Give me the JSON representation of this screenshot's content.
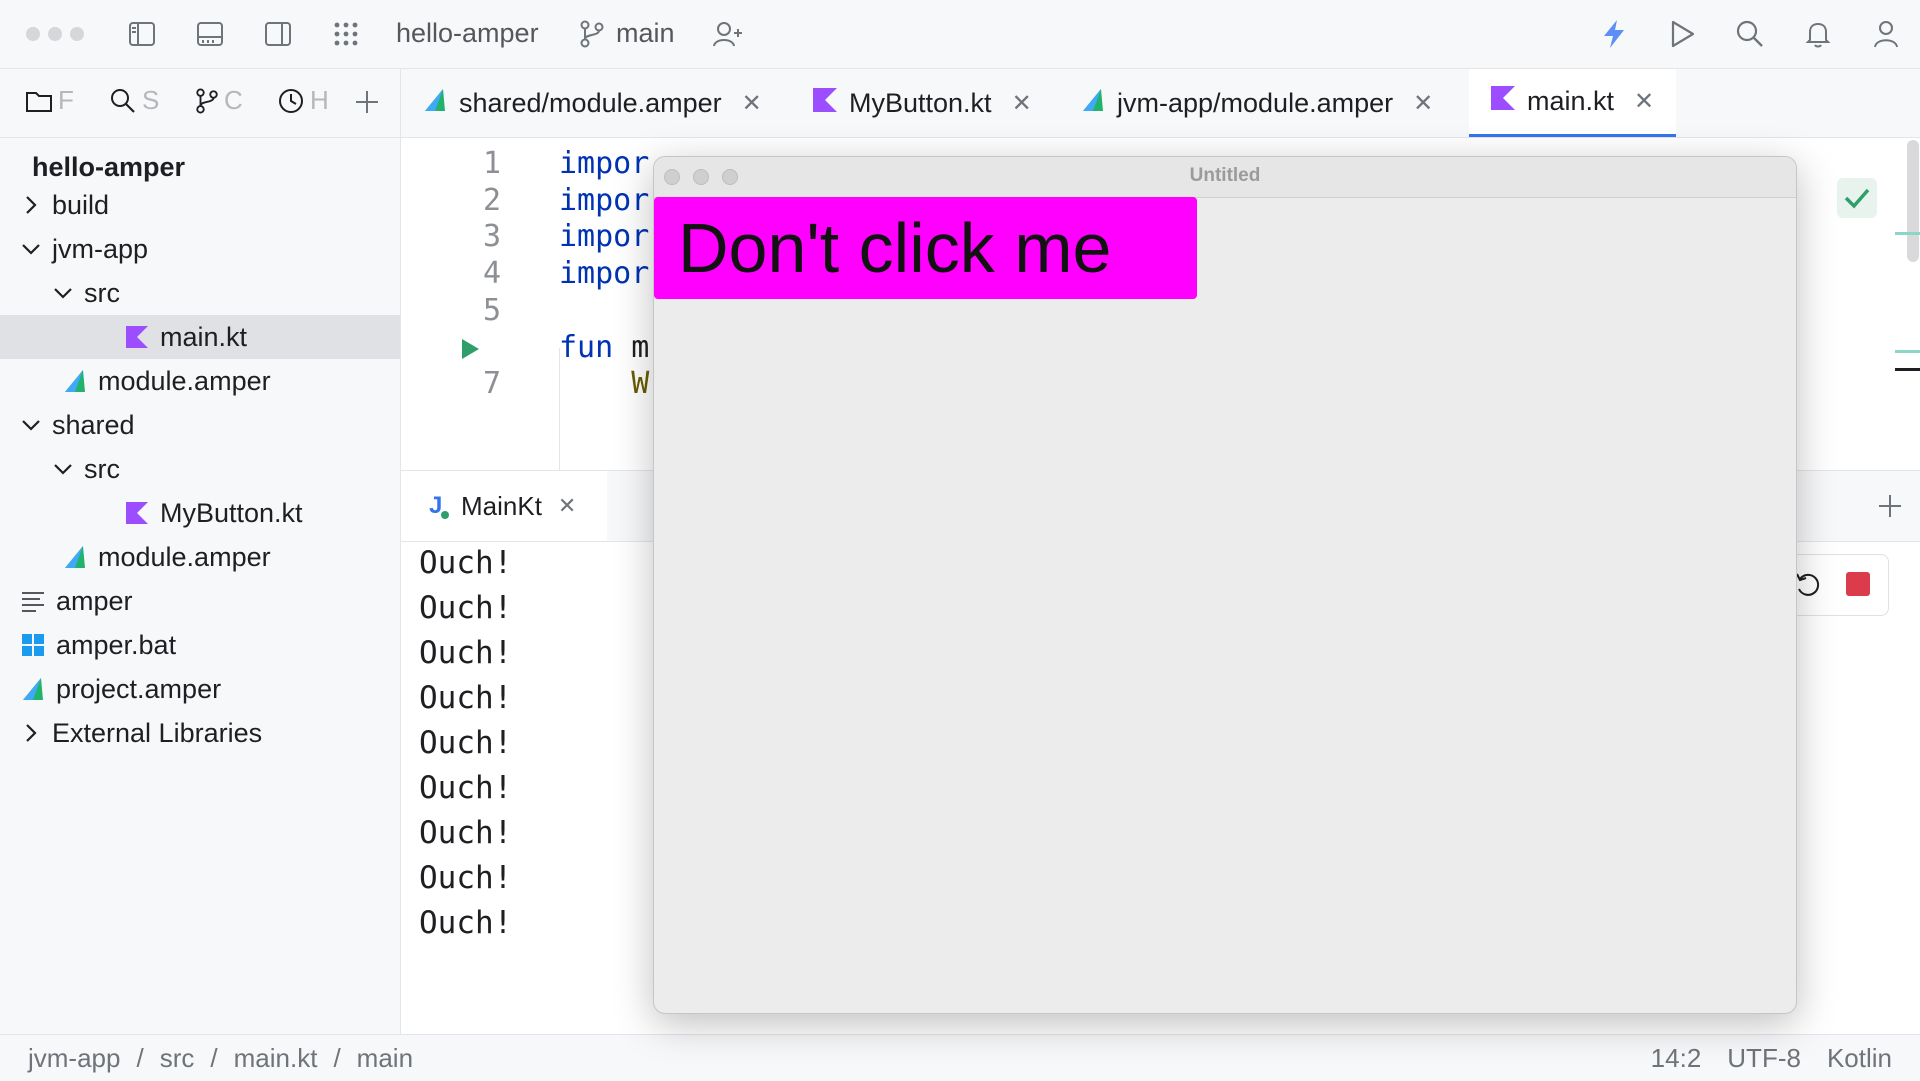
{
  "titlebar": {
    "project_name": "hello-amper",
    "branch": "main"
  },
  "tool_tabs": [
    {
      "icon": "folder-icon",
      "label": "F"
    },
    {
      "icon": "search-icon",
      "label": "S"
    },
    {
      "icon": "git-branch-icon",
      "label": "C"
    },
    {
      "icon": "clock-icon",
      "label": "H"
    }
  ],
  "tree": {
    "root": "hello-amper",
    "items": [
      {
        "label": "build",
        "depth": 0,
        "arrow": "right",
        "icon": ""
      },
      {
        "label": "jvm-app",
        "depth": 0,
        "arrow": "down",
        "icon": ""
      },
      {
        "label": "src",
        "depth": 1,
        "arrow": "down",
        "icon": ""
      },
      {
        "label": "main.kt",
        "depth": 2,
        "arrow": "",
        "icon": "kotlin-icon",
        "selected": true
      },
      {
        "label": "module.amper",
        "depth": 1,
        "arrow": "",
        "icon": "amper-icon"
      },
      {
        "label": "shared",
        "depth": 0,
        "arrow": "down",
        "icon": ""
      },
      {
        "label": "src",
        "depth": 1,
        "arrow": "down",
        "icon": ""
      },
      {
        "label": "MyButton.kt",
        "depth": 2,
        "arrow": "",
        "icon": "kotlin-icon"
      },
      {
        "label": "module.amper",
        "depth": 1,
        "arrow": "",
        "icon": "amper-icon"
      },
      {
        "label": "amper",
        "depth": 0,
        "arrow": "",
        "icon": "text-file-icon"
      },
      {
        "label": "amper.bat",
        "depth": 0,
        "arrow": "",
        "icon": "windows-icon"
      },
      {
        "label": "project.amper",
        "depth": 0,
        "arrow": "",
        "icon": "amper-icon"
      },
      {
        "label": "External Libraries",
        "depth": 0,
        "arrow": "right",
        "icon": ""
      }
    ]
  },
  "editor_tabs": [
    {
      "label": "shared/module.amper",
      "icon": "amper-icon"
    },
    {
      "label": "MyButton.kt",
      "icon": "kotlin-icon"
    },
    {
      "label": "jvm-app/module.amper",
      "icon": "amper-icon"
    },
    {
      "label": "main.kt",
      "icon": "kotlin-icon",
      "active": true
    }
  ],
  "editor": {
    "lines": [
      {
        "num": "1",
        "text": "impor",
        "cls": "kw"
      },
      {
        "num": "2",
        "text": "impor",
        "cls": "kw"
      },
      {
        "num": "3",
        "text": "impor",
        "cls": "kw"
      },
      {
        "num": "4",
        "text": "impor",
        "cls": "kw"
      },
      {
        "num": "5",
        "text": "",
        "cls": ""
      },
      {
        "num": "",
        "text": "fun m",
        "cls": "fun"
      },
      {
        "num": "7",
        "text": "    W",
        "cls": "call"
      }
    ]
  },
  "run": {
    "tab_label": "MainKt",
    "output": [
      "Ouch!",
      "Ouch!",
      "Ouch!",
      "Ouch!",
      "Ouch!",
      "Ouch!",
      "Ouch!",
      "Ouch!",
      "Ouch!"
    ]
  },
  "window": {
    "title": "Untitled",
    "button_label": "Don't click me",
    "button_color": "#ff00ff"
  },
  "status": {
    "breadcrumbs": [
      "jvm-app",
      "src",
      "main.kt",
      "main"
    ],
    "position": "14:2",
    "encoding": "UTF-8",
    "language": "Kotlin"
  },
  "colors": {
    "kotlin_icon": "#9b4dff",
    "amper_icon": "#21b36b",
    "accent": "#3574f0",
    "run_green": "#2f9e6a",
    "stop_red": "#db3b4b"
  }
}
